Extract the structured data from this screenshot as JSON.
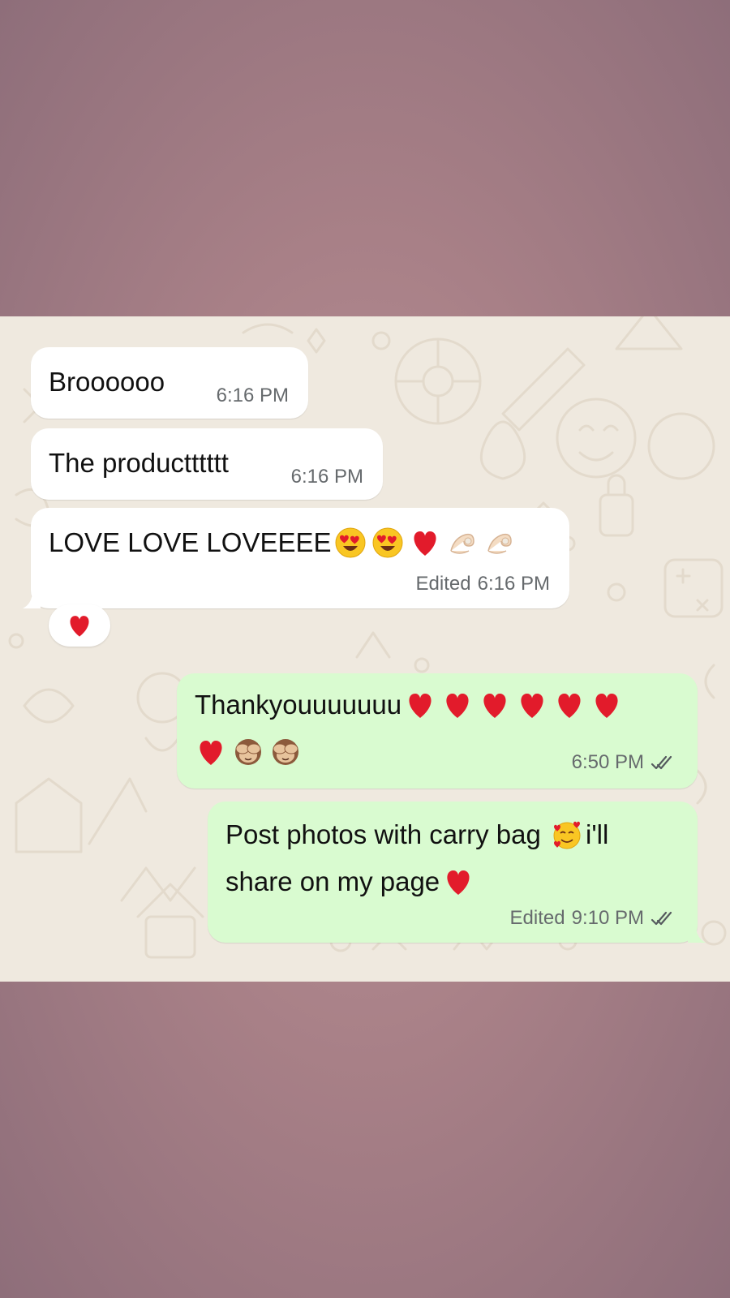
{
  "messages": [
    {
      "id": "m1",
      "direction": "incoming",
      "text": "Broooooo",
      "time": "6:16 PM"
    },
    {
      "id": "m2",
      "direction": "incoming",
      "text": "The productttttt",
      "time": "6:16 PM"
    },
    {
      "id": "m3",
      "direction": "incoming",
      "text": "LOVE LOVE LOVEEEE",
      "emoji": [
        "heart-eyes-emoji",
        "heart-eyes-emoji",
        "red-heart-emoji",
        "ok-hand-emoji",
        "ok-hand-emoji"
      ],
      "edited_label": "Edited",
      "time": "6:16 PM",
      "reaction": "❤"
    },
    {
      "id": "m4",
      "direction": "outgoing",
      "text": "Thankyouuuuuuu",
      "emoji": [
        "red-heart-emoji",
        "red-heart-emoji",
        "red-heart-emoji",
        "red-heart-emoji",
        "red-heart-emoji",
        "red-heart-emoji",
        "red-heart-emoji",
        "see-no-evil-monkey-emoji",
        "see-no-evil-monkey-emoji"
      ],
      "time": "6:50 PM",
      "status": "read"
    },
    {
      "id": "m5",
      "direction": "outgoing",
      "text_part1": "Post photos with carry bag ",
      "text_part2": "i'll",
      "text_part3": "share on my page",
      "emoji": [
        "smiling-face-with-hearts-emoji",
        "red-heart-emoji"
      ],
      "edited_label": "Edited",
      "time": "9:10 PM",
      "status": "read"
    }
  ],
  "colors": {
    "incoming_bubble": "#ffffff",
    "outgoing_bubble": "#d9fbd0",
    "chat_background": "#efe9df",
    "page_background": "#a88087",
    "heart": "#e21b2b",
    "timestamp": "#666a6d"
  }
}
